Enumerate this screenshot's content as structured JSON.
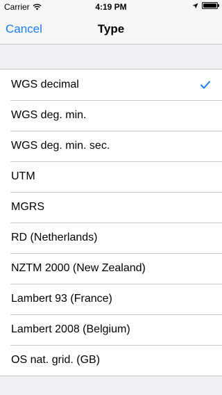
{
  "status_bar": {
    "carrier": "Carrier",
    "time": "4:19 PM"
  },
  "nav": {
    "cancel_label": "Cancel",
    "title": "Type"
  },
  "list": {
    "items": [
      {
        "label": "WGS decimal",
        "selected": true
      },
      {
        "label": "WGS deg. min."
      },
      {
        "label": "WGS deg. min. sec."
      },
      {
        "label": "UTM"
      },
      {
        "label": "MGRS"
      },
      {
        "label": "RD (Netherlands)"
      },
      {
        "label": "NZTM 2000 (New Zealand)"
      },
      {
        "label": "Lambert 93 (France)"
      },
      {
        "label": "Lambert 2008 (Belgium)"
      },
      {
        "label": "OS nat. grid. (GB)"
      }
    ]
  },
  "colors": {
    "accent": "#1a7cf5"
  },
  "icons": {
    "wifi": "wifi-icon",
    "location": "location-arrow-icon",
    "battery": "battery-icon",
    "check": "checkmark-icon"
  }
}
